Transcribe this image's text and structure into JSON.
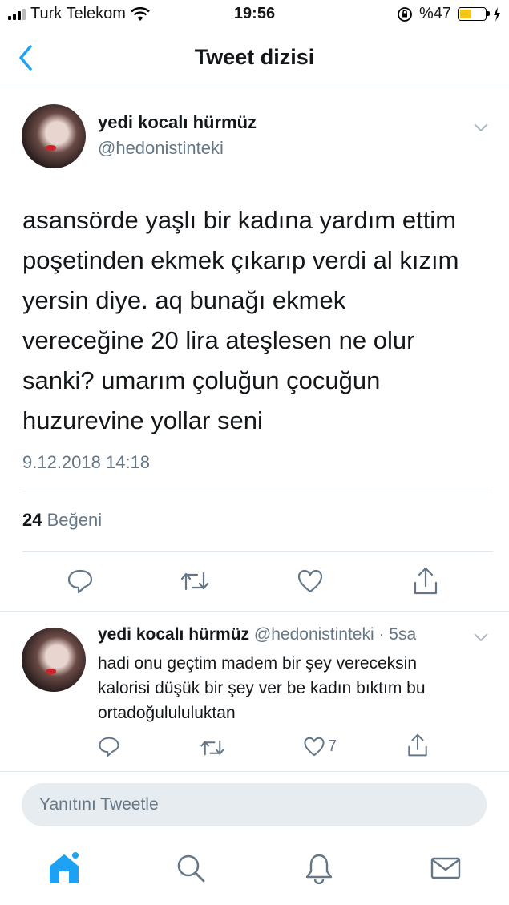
{
  "status_bar": {
    "carrier": "Turk Telekom",
    "time": "19:56",
    "battery": "%47",
    "battery_level": 0.47
  },
  "nav": {
    "title": "Tweet dizisi"
  },
  "tweet": {
    "author_name": "yedi kocalı hürmüz",
    "author_handle": "@hedonistinteki",
    "lines": [
      "asansörde yaşlı bir kadına yardım ettim",
      "poşetinden ekmek çıkarıp verdi al kızım",
      "yersin diye. aq bunağı ekmek",
      "vereceğine 20 lira ateşlesen ne olur",
      "sanki? umarım çoluğun çocuğun",
      "huzurevine yollar seni"
    ],
    "timestamp": "9.12.2018 14:18",
    "like_count": "24",
    "like_label": "Beğeni"
  },
  "reply": {
    "author_name": "yedi kocalı hürmüz",
    "meta": "@hedonistinteki · 5sa",
    "lines": [
      "hadi onu geçtim madem bir şey vereceksin",
      "kalorisi düşük bir şey ver be kadın bıktım bu",
      "ortadoğulululuktan"
    ],
    "like_count": "7"
  },
  "compose": {
    "placeholder": "Yanıtını Tweetle"
  },
  "tabs": [
    {
      "name": "home-icon",
      "active": true
    },
    {
      "name": "search-icon",
      "active": false
    },
    {
      "name": "bell-icon",
      "active": false
    },
    {
      "name": "mail-icon",
      "active": false
    }
  ],
  "colors": {
    "accent": "#1da1f2",
    "secondary_text": "#657786",
    "divider": "#e1e8ed"
  }
}
